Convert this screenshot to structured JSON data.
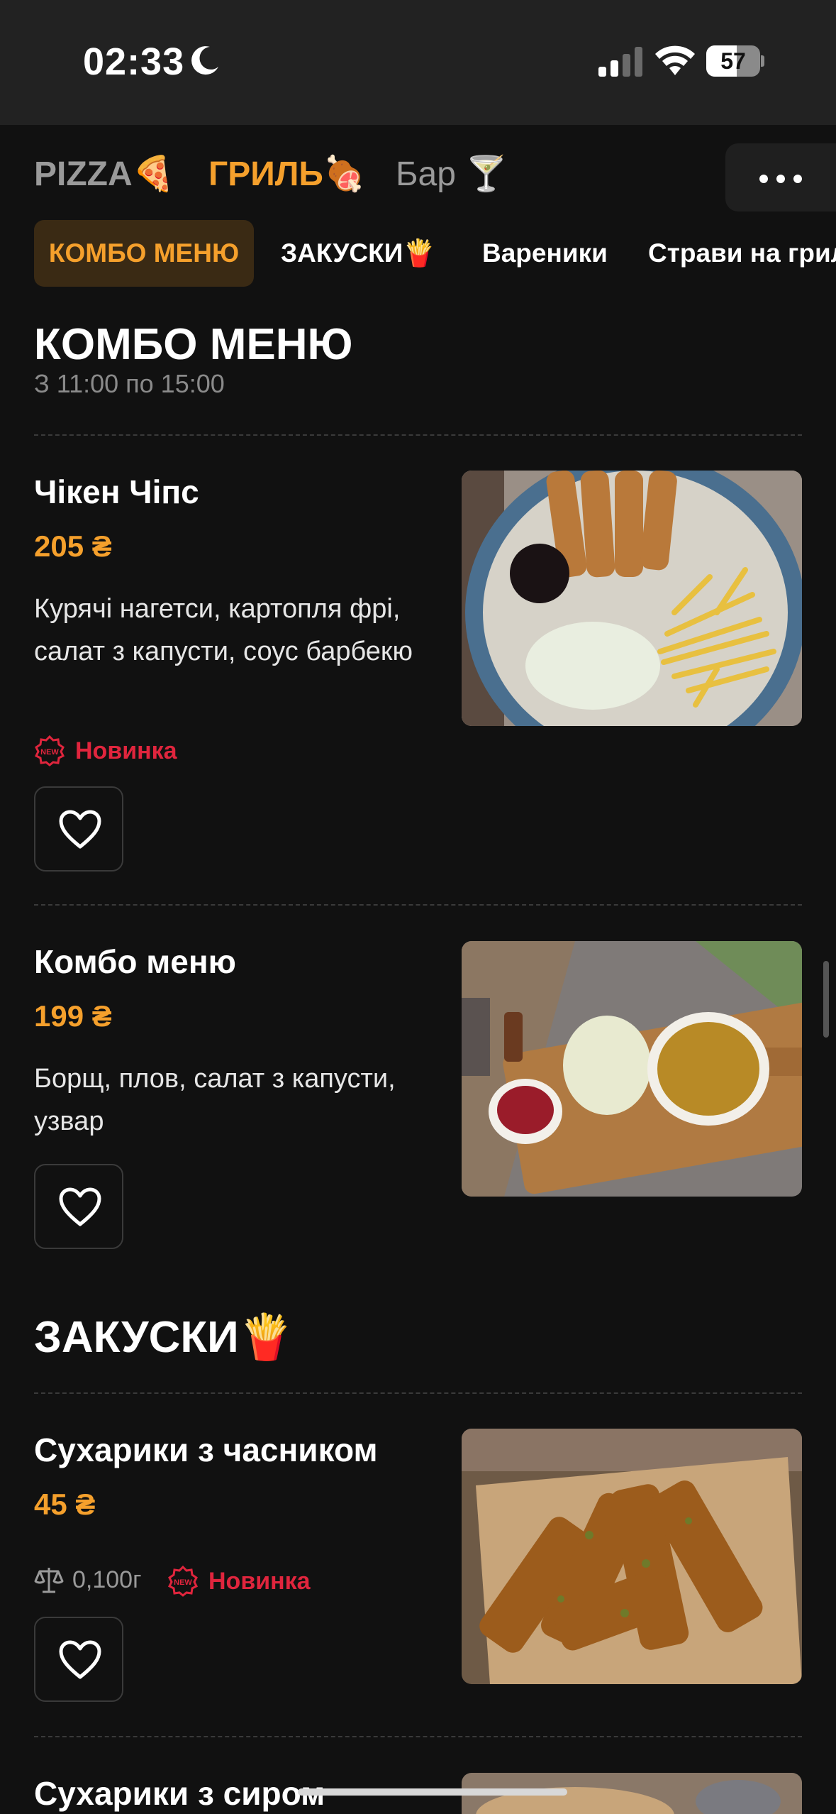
{
  "status_bar": {
    "time": "02:33",
    "battery": "57",
    "battery_level": 0.57
  },
  "top_tabs": [
    {
      "label": "PIZZA🍕",
      "active": false
    },
    {
      "label": "ГРИЛЬ🍖",
      "active": true
    },
    {
      "label": "Бар 🍸",
      "active": false
    }
  ],
  "more_icon": "more-horizontal-icon",
  "categories": [
    {
      "label": "КОМБО МЕНЮ",
      "active": true
    },
    {
      "label": "ЗАКУСКИ🍟",
      "active": false
    },
    {
      "label": "Вареники",
      "active": false
    },
    {
      "label": "Страви на грилі",
      "active": false
    }
  ],
  "sections": [
    {
      "title": "КОМБО МЕНЮ",
      "subtitle": "З 11:00 по 15:00",
      "items": [
        {
          "name": "Чікен Чіпс",
          "price": "205 ₴",
          "description": "Курячі нагетси, картопля фрі, салат з капусти, соус барбекю",
          "badge": "Новинка"
        },
        {
          "name": "Комбо меню",
          "price": "199 ₴",
          "description": "Борщ, плов, салат з капусти, узвар"
        }
      ]
    },
    {
      "title": "ЗАКУСКИ🍟",
      "items": [
        {
          "name": "Сухарики з часником",
          "price": "45 ₴",
          "weight": "0,100г",
          "badge": "Новинка"
        },
        {
          "name": "Сухарики з сиром"
        }
      ]
    }
  ],
  "colors": {
    "accent": "#f5a02c",
    "badge": "#e0253d",
    "background": "#111111",
    "status_bar": "#222222"
  }
}
